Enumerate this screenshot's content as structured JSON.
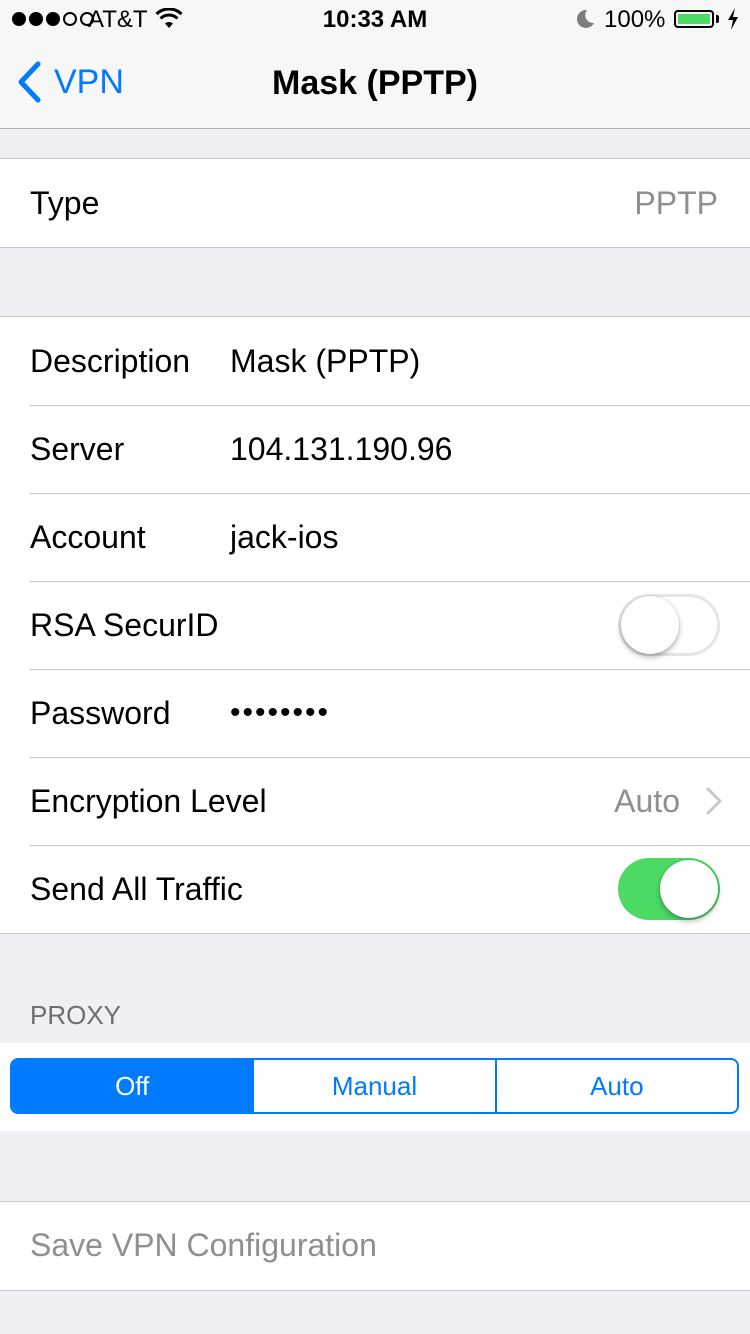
{
  "status_bar": {
    "carrier": "AT&T",
    "time": "10:33 AM",
    "battery_percent": "100%",
    "signal_bars_filled": 3,
    "signal_bars_total": 5
  },
  "nav": {
    "back_label": "VPN",
    "title": "Mask (PPTP)"
  },
  "type_row": {
    "label": "Type",
    "value": "PPTP"
  },
  "fields": {
    "description": {
      "label": "Description",
      "value": "Mask (PPTP)"
    },
    "server": {
      "label": "Server",
      "value": "104.131.190.96"
    },
    "account": {
      "label": "Account",
      "value": "jack-ios"
    },
    "rsa": {
      "label": "RSA SecurID",
      "enabled": false
    },
    "password": {
      "label": "Password",
      "value": "••••••••"
    },
    "encryption": {
      "label": "Encryption Level",
      "value": "Auto"
    },
    "send_all": {
      "label": "Send All Traffic",
      "enabled": true
    }
  },
  "proxy": {
    "header": "PROXY",
    "options": [
      "Off",
      "Manual",
      "Auto"
    ],
    "selected": "Off"
  },
  "save": {
    "label": "Save VPN Configuration"
  },
  "colors": {
    "accent": "#007aff",
    "toggle_on": "#4cd964",
    "background": "#efeff4",
    "secondary_text": "#8e8e93"
  }
}
